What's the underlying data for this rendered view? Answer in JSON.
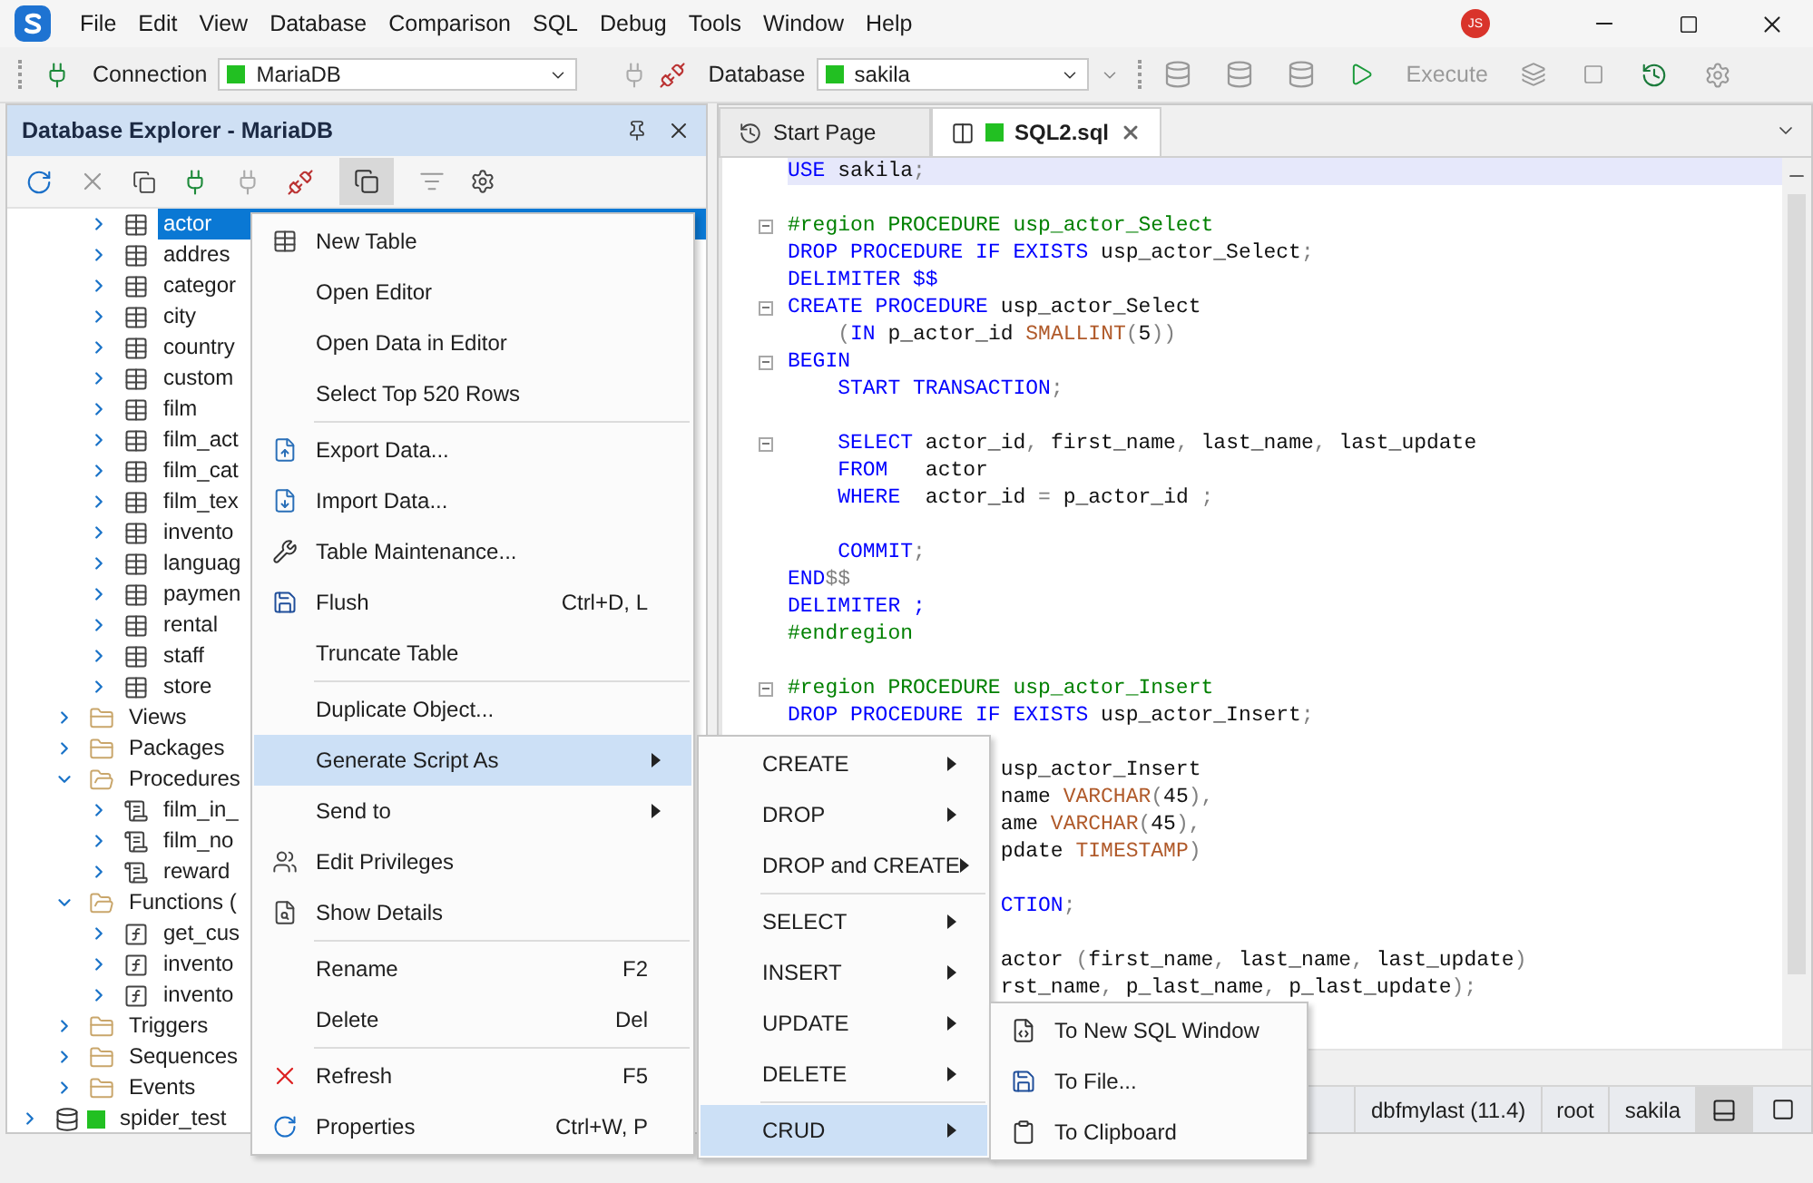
{
  "app_menu": [
    "File",
    "Edit",
    "View",
    "Database",
    "Comparison",
    "SQL",
    "Debug",
    "Tools",
    "Window",
    "Help"
  ],
  "user_badge": "JS",
  "toolbar": {
    "connection_label": "Connection",
    "connection": {
      "value": "MariaDB",
      "color": "#22c022"
    },
    "database_label": "Database",
    "database": {
      "value": "sakila",
      "color": "#22c022"
    },
    "execute": {
      "label": "Execute",
      "disabled": true
    }
  },
  "explorer": {
    "title": "Database Explorer - MariaDB",
    "tree": [
      {
        "kind": "table",
        "label": "actor",
        "selected": true,
        "expanded": false
      },
      {
        "kind": "table",
        "label": "addres",
        "selected": false,
        "expanded": false
      },
      {
        "kind": "table",
        "label": "categor",
        "selected": false,
        "expanded": false
      },
      {
        "kind": "table",
        "label": "city",
        "selected": false,
        "expanded": false
      },
      {
        "kind": "table",
        "label": "country",
        "selected": false,
        "expanded": false
      },
      {
        "kind": "table",
        "label": "custom",
        "selected": false,
        "expanded": false
      },
      {
        "kind": "table",
        "label": "film",
        "selected": false,
        "expanded": false
      },
      {
        "kind": "table",
        "label": "film_act",
        "selected": false,
        "expanded": false
      },
      {
        "kind": "table",
        "label": "film_cat",
        "selected": false,
        "expanded": false
      },
      {
        "kind": "table",
        "label": "film_tex",
        "selected": false,
        "expanded": false
      },
      {
        "kind": "table",
        "label": "invento",
        "selected": false,
        "expanded": false
      },
      {
        "kind": "table",
        "label": "languag",
        "selected": false,
        "expanded": false
      },
      {
        "kind": "table",
        "label": "paymen",
        "selected": false,
        "expanded": false
      },
      {
        "kind": "table",
        "label": "rental",
        "selected": false,
        "expanded": false
      },
      {
        "kind": "table",
        "label": "staff",
        "selected": false,
        "expanded": false
      },
      {
        "kind": "table",
        "label": "store",
        "selected": false,
        "expanded": false
      },
      {
        "kind": "folder",
        "label": "Views",
        "selected": false,
        "expanded": false
      },
      {
        "kind": "folder",
        "label": "Packages",
        "selected": false,
        "expanded": false
      },
      {
        "kind": "folder",
        "label": "Procedures",
        "selected": false,
        "expanded": true,
        "children": [
          {
            "kind": "procedure",
            "label": "film_in_",
            "selected": false,
            "expanded": false
          },
          {
            "kind": "procedure",
            "label": "film_no",
            "selected": false,
            "expanded": false
          },
          {
            "kind": "procedure",
            "label": "reward",
            "selected": false,
            "expanded": false
          }
        ]
      },
      {
        "kind": "folder",
        "label": "Functions (",
        "selected": false,
        "expanded": true,
        "children": [
          {
            "kind": "function",
            "label": "get_cus",
            "selected": false,
            "expanded": false
          },
          {
            "kind": "function",
            "label": "invento",
            "selected": false,
            "expanded": false
          },
          {
            "kind": "function",
            "label": "invento",
            "selected": false,
            "expanded": false
          }
        ]
      },
      {
        "kind": "folder",
        "label": "Triggers",
        "selected": false,
        "expanded": false
      },
      {
        "kind": "folder",
        "label": "Sequences",
        "selected": false,
        "expanded": false
      },
      {
        "kind": "folder",
        "label": "Events",
        "selected": false,
        "expanded": false
      },
      {
        "kind": "database",
        "label": "spider_test",
        "selected": false,
        "expanded": false,
        "color": "#22c022"
      }
    ]
  },
  "tabs": [
    {
      "label": "Start Page",
      "selected": false
    },
    {
      "label": "SQL2.sql",
      "selected": true,
      "color": "#22c022"
    }
  ],
  "editor": {
    "lines": [
      {
        "kind": "full",
        "current": true,
        "fold": false,
        "tokens": [
          {
            "kind": "kw",
            "text": "USE"
          },
          {
            "kind": "id",
            "text": " sakila"
          },
          {
            "kind": "p",
            "text": ";"
          }
        ]
      },
      {
        "kind": "full",
        "current": false,
        "fold": false
      },
      {
        "kind": "full",
        "current": false,
        "fold": true,
        "tokens": [
          {
            "kind": "rg",
            "text": "#region PROCEDURE usp_actor_Select"
          }
        ]
      },
      {
        "kind": "full",
        "current": false,
        "fold": false,
        "tokens": [
          {
            "kind": "kw",
            "text": "DROP PROCEDURE IF EXISTS"
          },
          {
            "kind": "id",
            "text": " usp_actor_Select"
          },
          {
            "kind": "p",
            "text": ";"
          }
        ]
      },
      {
        "kind": "full",
        "current": false,
        "fold": false,
        "tokens": [
          {
            "kind": "kw",
            "text": "DELIMITER $$"
          }
        ]
      },
      {
        "kind": "full",
        "current": false,
        "fold": true,
        "tokens": [
          {
            "kind": "kw",
            "text": "CREATE PROCEDURE"
          },
          {
            "kind": "id",
            "text": " usp_actor_Select"
          }
        ]
      },
      {
        "kind": "full",
        "current": false,
        "fold": false,
        "tokens": [
          {
            "kind": "p",
            "text": "    ("
          },
          {
            "kind": "kw",
            "text": "IN"
          },
          {
            "kind": "id",
            "text": " p_actor_id "
          },
          {
            "kind": "ty",
            "text": "SMALLINT"
          },
          {
            "kind": "p",
            "text": "("
          },
          {
            "kind": "id",
            "text": "5"
          },
          {
            "kind": "p",
            "text": "))"
          }
        ]
      },
      {
        "kind": "full",
        "current": false,
        "fold": true,
        "tokens": [
          {
            "kind": "kw",
            "text": "BEGIN"
          }
        ]
      },
      {
        "kind": "full",
        "current": false,
        "fold": false,
        "tokens": [
          {
            "kind": "kw",
            "text": "    START TRANSACTION"
          },
          {
            "kind": "p",
            "text": ";"
          }
        ]
      },
      {
        "kind": "full",
        "current": false,
        "fold": false
      },
      {
        "kind": "full",
        "current": false,
        "fold": true,
        "tokens": [
          {
            "kind": "kw",
            "text": "    SELECT"
          },
          {
            "kind": "id",
            "text": " actor_id"
          },
          {
            "kind": "p",
            "text": ","
          },
          {
            "kind": "id",
            "text": " first_name"
          },
          {
            "kind": "p",
            "text": ","
          },
          {
            "kind": "id",
            "text": " last_name"
          },
          {
            "kind": "p",
            "text": ","
          },
          {
            "kind": "id",
            "text": " last_update"
          }
        ]
      },
      {
        "kind": "full",
        "current": false,
        "fold": false,
        "tokens": [
          {
            "kind": "kw",
            "text": "    FROM"
          },
          {
            "kind": "id",
            "text": "   actor"
          }
        ]
      },
      {
        "kind": "full",
        "current": false,
        "fold": false,
        "tokens": [
          {
            "kind": "kw",
            "text": "    WHERE"
          },
          {
            "kind": "id",
            "text": "  actor_id "
          },
          {
            "kind": "p",
            "text": "="
          },
          {
            "kind": "id",
            "text": " p_actor_id "
          },
          {
            "kind": "p",
            "text": ";"
          }
        ]
      },
      {
        "kind": "full",
        "current": false,
        "fold": false
      },
      {
        "kind": "full",
        "current": false,
        "fold": false,
        "tokens": [
          {
            "kind": "kw",
            "text": "    COMMIT"
          },
          {
            "kind": "p",
            "text": ";"
          }
        ]
      },
      {
        "kind": "full",
        "current": false,
        "fold": false,
        "tokens": [
          {
            "kind": "kw",
            "text": "END"
          },
          {
            "kind": "p",
            "text": "$$"
          }
        ]
      },
      {
        "kind": "full",
        "current": false,
        "fold": false,
        "tokens": [
          {
            "kind": "kw",
            "text": "DELIMITER ;"
          }
        ]
      },
      {
        "kind": "full",
        "current": false,
        "fold": false,
        "tokens": [
          {
            "kind": "rg",
            "text": "#endregion"
          }
        ]
      },
      {
        "kind": "full",
        "current": false,
        "fold": false
      },
      {
        "kind": "full",
        "current": false,
        "fold": true,
        "tokens": [
          {
            "kind": "rg",
            "text": "#region PROCEDURE usp_actor_Insert"
          }
        ]
      },
      {
        "kind": "full",
        "current": false,
        "fold": false,
        "tokens": [
          {
            "kind": "kw",
            "text": "DROP PROCEDURE IF EXISTS"
          },
          {
            "kind": "id",
            "text": " usp_actor_Insert"
          },
          {
            "kind": "p",
            "text": ";"
          }
        ]
      },
      {
        "kind": "covered",
        "current": false
      },
      {
        "kind": "covered",
        "current": false,
        "tokens": [
          {
            "kind": "id",
            "text": "usp_actor_Insert"
          }
        ]
      },
      {
        "kind": "covered",
        "current": false,
        "tokens": [
          {
            "kind": "id",
            "text": "name "
          },
          {
            "kind": "ty",
            "text": "VARCHAR"
          },
          {
            "kind": "p",
            "text": "("
          },
          {
            "kind": "id",
            "text": "45"
          },
          {
            "kind": "p",
            "text": "),"
          }
        ]
      },
      {
        "kind": "covered",
        "current": false,
        "tokens": [
          {
            "kind": "id",
            "text": "ame "
          },
          {
            "kind": "ty",
            "text": "VARCHAR"
          },
          {
            "kind": "p",
            "text": "("
          },
          {
            "kind": "id",
            "text": "45"
          },
          {
            "kind": "p",
            "text": "),"
          }
        ]
      },
      {
        "kind": "covered",
        "current": false,
        "tokens": [
          {
            "kind": "id",
            "text": "pdate "
          },
          {
            "kind": "ty",
            "text": "TIMESTAMP"
          },
          {
            "kind": "p",
            "text": ")"
          }
        ]
      },
      {
        "kind": "covered",
        "current": false
      },
      {
        "kind": "covered",
        "current": false,
        "tokens": [
          {
            "kind": "kw",
            "text": "CTION"
          },
          {
            "kind": "p",
            "text": ";"
          }
        ]
      },
      {
        "kind": "covered",
        "current": false
      },
      {
        "kind": "covered",
        "current": false,
        "tokens": [
          {
            "kind": "id",
            "text": "actor "
          },
          {
            "kind": "p",
            "text": "("
          },
          {
            "kind": "id",
            "text": "first_name"
          },
          {
            "kind": "p",
            "text": ","
          },
          {
            "kind": "id",
            "text": " last_name"
          },
          {
            "kind": "p",
            "text": ","
          },
          {
            "kind": "id",
            "text": " last_update"
          },
          {
            "kind": "p",
            "text": ")"
          }
        ]
      },
      {
        "kind": "covered",
        "current": false,
        "tokens": [
          {
            "kind": "id",
            "text": "rst_name"
          },
          {
            "kind": "p",
            "text": ","
          },
          {
            "kind": "id",
            "text": " p_last_name"
          },
          {
            "kind": "p",
            "text": ","
          },
          {
            "kind": "id",
            "text": " p_last_update"
          },
          {
            "kind": "p",
            "text": ");"
          }
        ]
      }
    ]
  },
  "status_bar": [
    "dbfmylast (11.4)",
    "root",
    "sakila"
  ],
  "context_menu": {
    "groups": [
      [
        {
          "label": "New Table",
          "selected": false,
          "submenu": false
        },
        {
          "label": "Open Editor",
          "selected": false,
          "submenu": false
        },
        {
          "label": "Open Data in Editor",
          "selected": false,
          "submenu": false
        },
        {
          "label": "Select Top 520 Rows",
          "selected": false,
          "submenu": false
        }
      ],
      [
        {
          "label": "Export Data...",
          "selected": false,
          "submenu": false
        },
        {
          "label": "Import Data...",
          "selected": false,
          "submenu": false
        },
        {
          "label": "Table Maintenance...",
          "selected": false,
          "submenu": false
        },
        {
          "label": "Flush",
          "shortcut": "Ctrl+D, L",
          "selected": false,
          "submenu": false
        },
        {
          "label": "Truncate Table",
          "selected": false,
          "submenu": false
        }
      ],
      [
        {
          "label": "Duplicate Object...",
          "selected": false,
          "submenu": false
        },
        {
          "label": "Generate Script As",
          "selected": true,
          "submenu": true
        },
        {
          "label": "Send to",
          "selected": false,
          "submenu": true
        },
        {
          "label": "Edit Privileges",
          "selected": false,
          "submenu": false
        },
        {
          "label": "Show Details",
          "selected": false,
          "submenu": false
        }
      ],
      [
        {
          "label": "Rename",
          "shortcut": "F2",
          "selected": false,
          "submenu": false
        },
        {
          "label": "Delete",
          "shortcut": "Del",
          "selected": false,
          "submenu": false
        }
      ],
      [
        {
          "label": "Refresh",
          "shortcut": "F5",
          "selected": false,
          "submenu": false
        },
        {
          "label": "Properties",
          "shortcut": "Ctrl+W, P",
          "selected": false,
          "submenu": false
        }
      ]
    ]
  },
  "script_submenu": {
    "groups": [
      [
        {
          "label": "CREATE",
          "selected": false,
          "submenu": true
        },
        {
          "label": "DROP",
          "selected": false,
          "submenu": true
        },
        {
          "label": "DROP and CREATE",
          "selected": false,
          "submenu": true
        }
      ],
      [
        {
          "label": "SELECT",
          "selected": false,
          "submenu": true
        },
        {
          "label": "INSERT",
          "selected": false,
          "submenu": true
        },
        {
          "label": "UPDATE",
          "selected": false,
          "submenu": true
        },
        {
          "label": "DELETE",
          "selected": false,
          "submenu": true
        }
      ],
      [
        {
          "label": "CRUD",
          "selected": true,
          "submenu": true
        }
      ]
    ]
  },
  "crud_submenu": {
    "groups": [
      [
        {
          "label": "To New SQL Window",
          "selected": false,
          "submenu": false
        },
        {
          "label": "To File...",
          "selected": false,
          "submenu": false
        },
        {
          "label": "To Clipboard",
          "selected": false,
          "submenu": false
        }
      ]
    ]
  }
}
